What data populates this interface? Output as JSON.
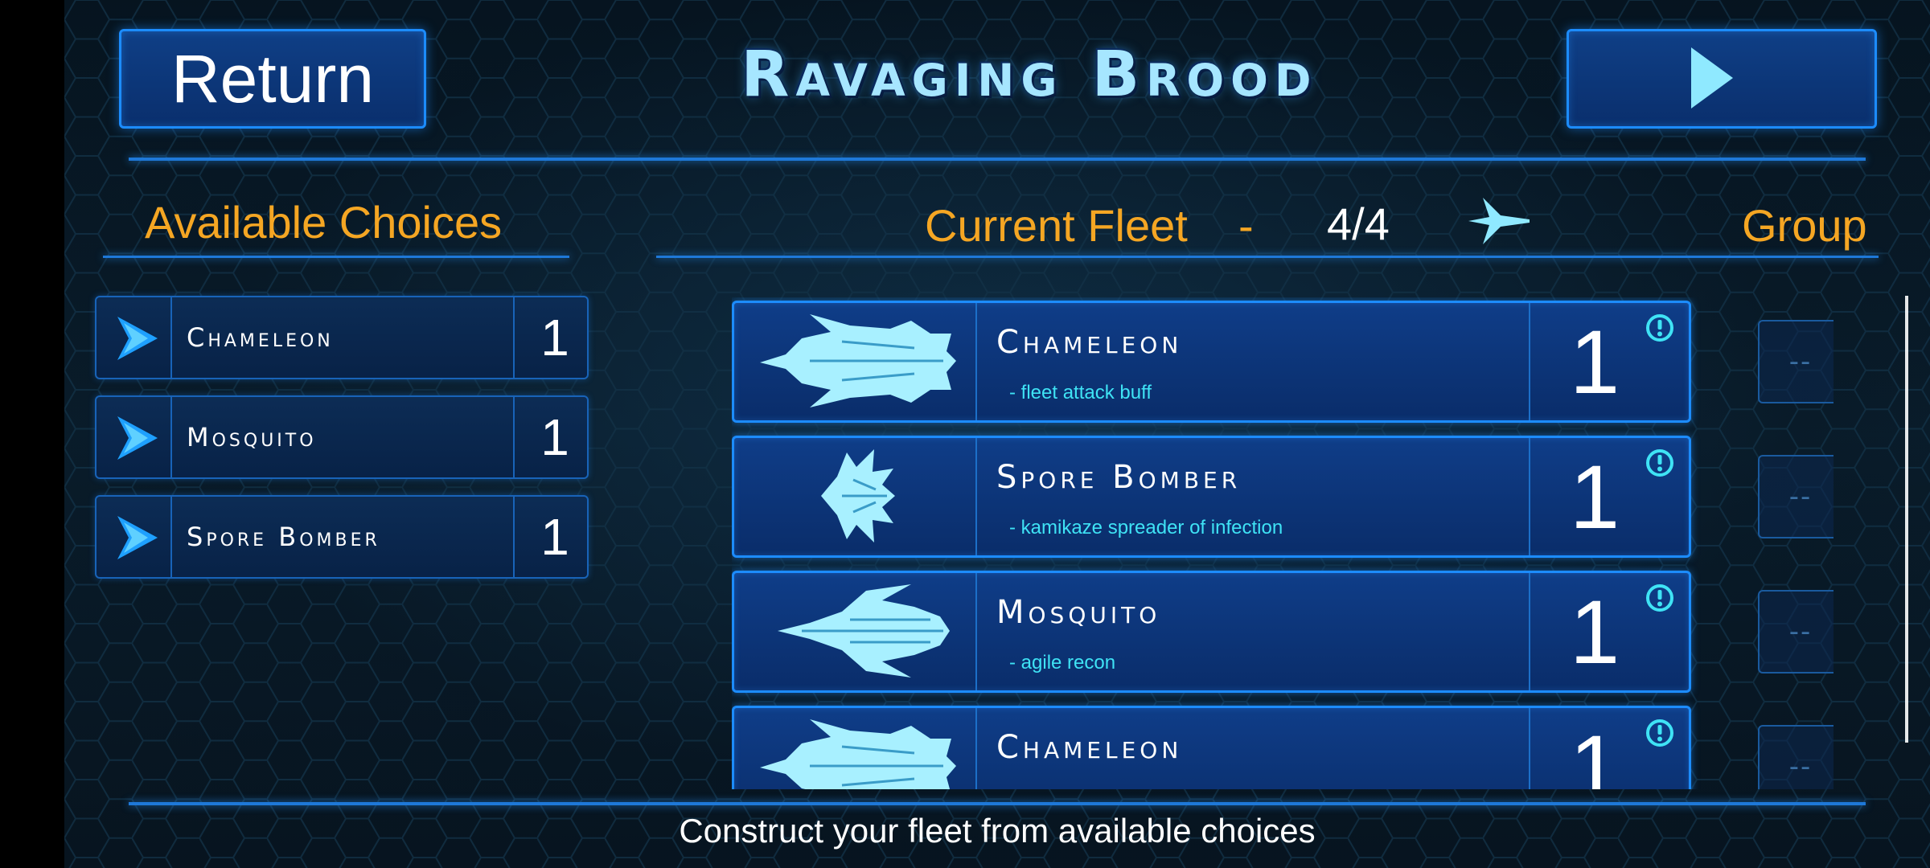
{
  "header": {
    "return_label": "Return",
    "title": "Ravaging Brood",
    "next_icon": "play-triangle-icon"
  },
  "available": {
    "heading": "Available Choices",
    "items": [
      {
        "name": "Chameleon",
        "count": "1"
      },
      {
        "name": "Mosquito",
        "count": "1"
      },
      {
        "name": "Spore Bomber",
        "count": "1"
      }
    ]
  },
  "fleet": {
    "heading": "Current Fleet",
    "dash": "-",
    "capacity": "4/4",
    "group_heading": "Group",
    "rows": [
      {
        "name": "Chameleon",
        "desc": "- fleet attack buff",
        "count": "1",
        "group": "--",
        "ship_icon": "chameleon-ship-icon"
      },
      {
        "name": "Spore Bomber",
        "desc": "- kamikaze spreader of infection",
        "count": "1",
        "group": "--",
        "ship_icon": "spore-bomber-ship-icon"
      },
      {
        "name": "Mosquito",
        "desc": "- agile recon",
        "count": "1",
        "group": "--",
        "ship_icon": "mosquito-ship-icon"
      },
      {
        "name": "Chameleon",
        "desc": "",
        "count": "1",
        "group": "--",
        "ship_icon": "chameleon-ship-icon"
      }
    ]
  },
  "footer": {
    "hint": "Construct your fleet from available choices"
  },
  "colors": {
    "accent_blue": "#1c8cff",
    "heading_orange": "#f5a623",
    "desc_cyan": "#3fe3f5",
    "title_light": "#a6e6ff"
  }
}
